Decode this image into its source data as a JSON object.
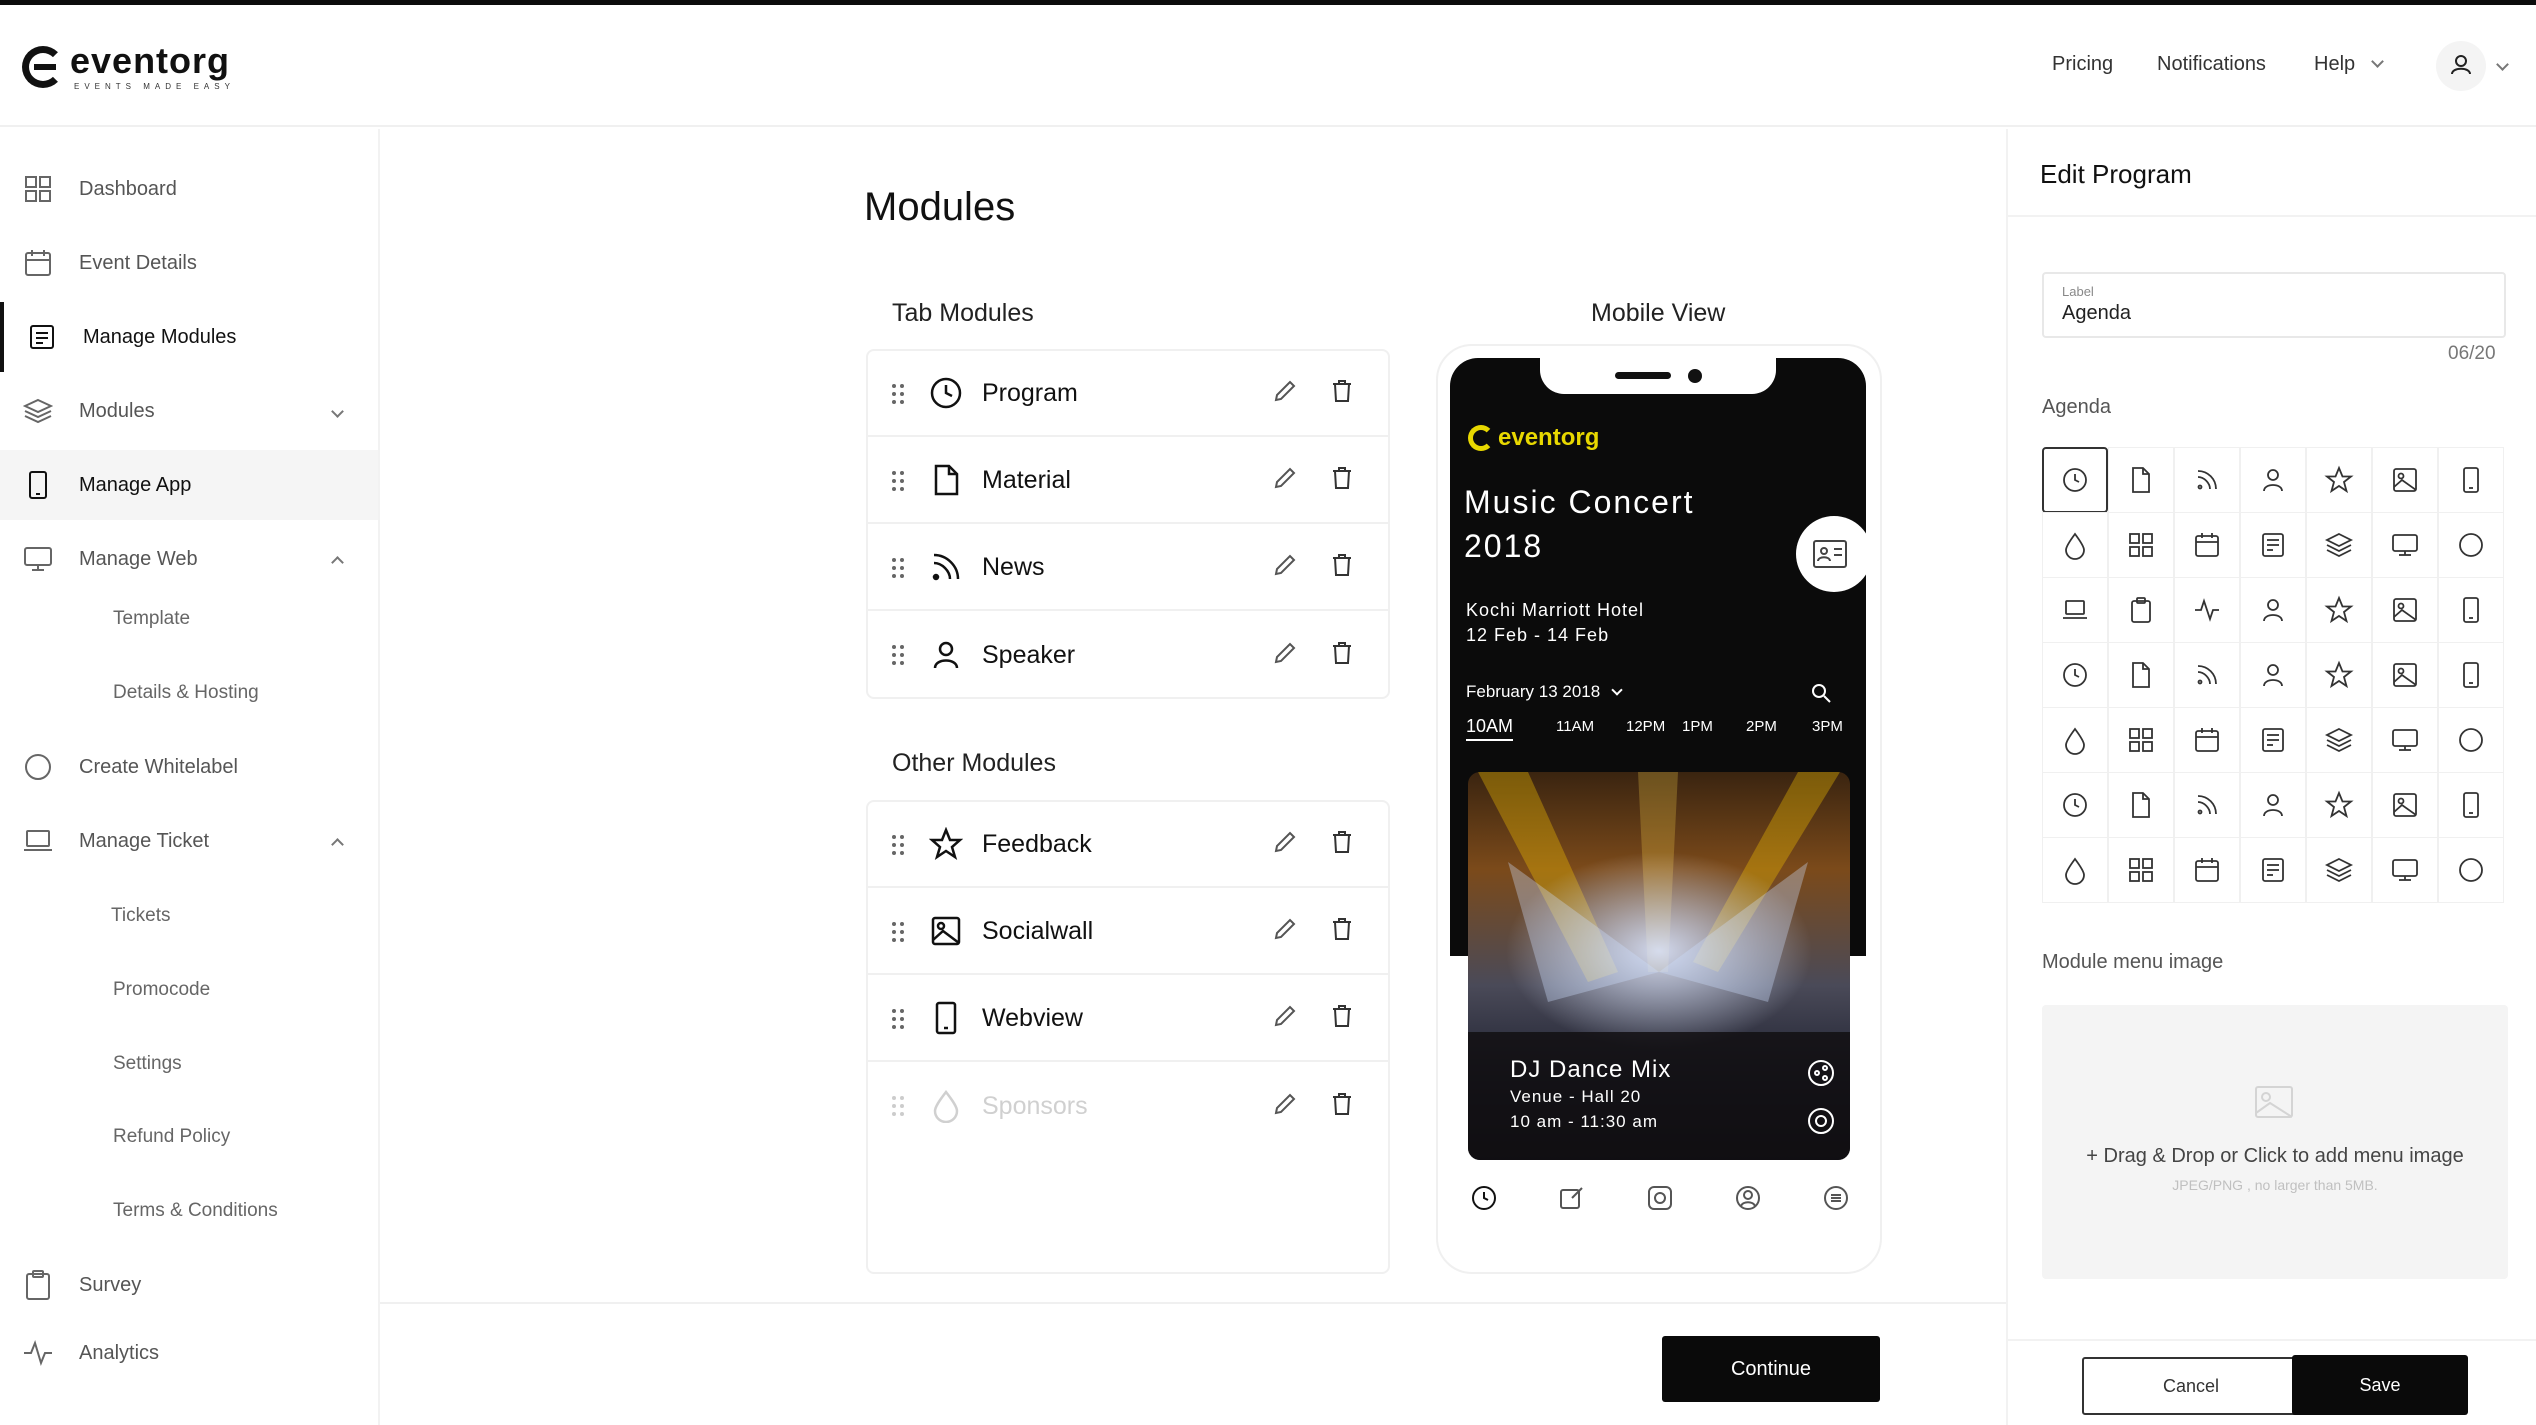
{
  "brand": {
    "name": "eventorg",
    "tagline": "EVENTS MADE EASY"
  },
  "topnav": {
    "pricing": "Pricing",
    "notifications": "Notifications",
    "help": "Help"
  },
  "sidebar": {
    "items": [
      {
        "label": "Dashboard",
        "icon": "grid-icon"
      },
      {
        "label": "Event Details",
        "icon": "calendar-icon"
      },
      {
        "label": "Manage Modules",
        "icon": "layout-icon"
      },
      {
        "label": "Modules",
        "icon": "layers-icon"
      },
      {
        "label": "Manage App",
        "icon": "mobile-icon"
      },
      {
        "label": "Manage Web",
        "icon": "monitor-icon"
      },
      {
        "label": "Create Whitelabel",
        "icon": "circle-icon"
      },
      {
        "label": "Manage Ticket",
        "icon": "laptop-icon"
      },
      {
        "label": "Survey",
        "icon": "clipboard-icon"
      },
      {
        "label": "Analytics",
        "icon": "activity-icon"
      }
    ],
    "web_sub": [
      "Template",
      "Details  & Hosting"
    ],
    "ticket_sub": [
      "Tickets",
      "Promocode",
      "Settings",
      "Refund Policy",
      "Terms  & Conditions"
    ]
  },
  "main": {
    "title": "Modules",
    "tab_modules_title": "Tab Modules",
    "other_modules_title": "Other Modules",
    "mobile_view_title": "Mobile View",
    "tab_modules": [
      {
        "label": "Program",
        "icon": "clock-icon"
      },
      {
        "label": "Material",
        "icon": "file-icon"
      },
      {
        "label": "News",
        "icon": "rss-icon"
      },
      {
        "label": "Speaker",
        "icon": "user-icon"
      }
    ],
    "other_modules": [
      {
        "label": "Feedback",
        "icon": "star-icon"
      },
      {
        "label": "Socialwall",
        "icon": "image-icon"
      },
      {
        "label": "Webview",
        "icon": "mobile-icon"
      },
      {
        "label": "Sponsors",
        "icon": "droplet-icon"
      }
    ],
    "continue_label": "Continue"
  },
  "phone": {
    "logo": "eventorg",
    "event_title": "Music Concert 2018",
    "venue": "Kochi Marriott Hotel",
    "dates": "12 Feb - 14 Feb",
    "date_selector": "February 13 2018",
    "times": [
      "10AM",
      "11AM",
      "12PM",
      "1PM",
      "2PM",
      "3PM"
    ],
    "card_title": "DJ Dance Mix",
    "card_venue": "Venue - Hall 20",
    "card_time": "10 am - 11:30 am"
  },
  "edit_panel": {
    "title": "Edit Program",
    "field_label": "Label",
    "field_value": "Agenda",
    "char_count": "06/20",
    "icon_section": "Agenda",
    "image_section": "Module menu image",
    "drop_text": "+ Drag & Drop or Click to add menu image",
    "drop_hint": "JPEG/PNG , no larger than 5MB.",
    "cancel_label": "Cancel",
    "save_label": "Save",
    "icon_grid": [
      [
        "clock",
        "file",
        "rss",
        "user",
        "star",
        "image",
        "mobile"
      ],
      [
        "droplet",
        "grid",
        "calendar",
        "layout",
        "layers",
        "monitor",
        "circle"
      ],
      [
        "laptop",
        "clipboard",
        "activity",
        "user",
        "star",
        "image",
        "mobile"
      ],
      [
        "clock",
        "file",
        "rss",
        "user",
        "star",
        "image",
        "mobile"
      ],
      [
        "droplet",
        "grid",
        "calendar",
        "layout",
        "layers",
        "monitor",
        "circle"
      ],
      [
        "clock",
        "file",
        "rss",
        "user",
        "star",
        "image",
        "mobile"
      ],
      [
        "droplet",
        "grid",
        "calendar",
        "layout",
        "layers",
        "monitor",
        "circle"
      ]
    ]
  }
}
